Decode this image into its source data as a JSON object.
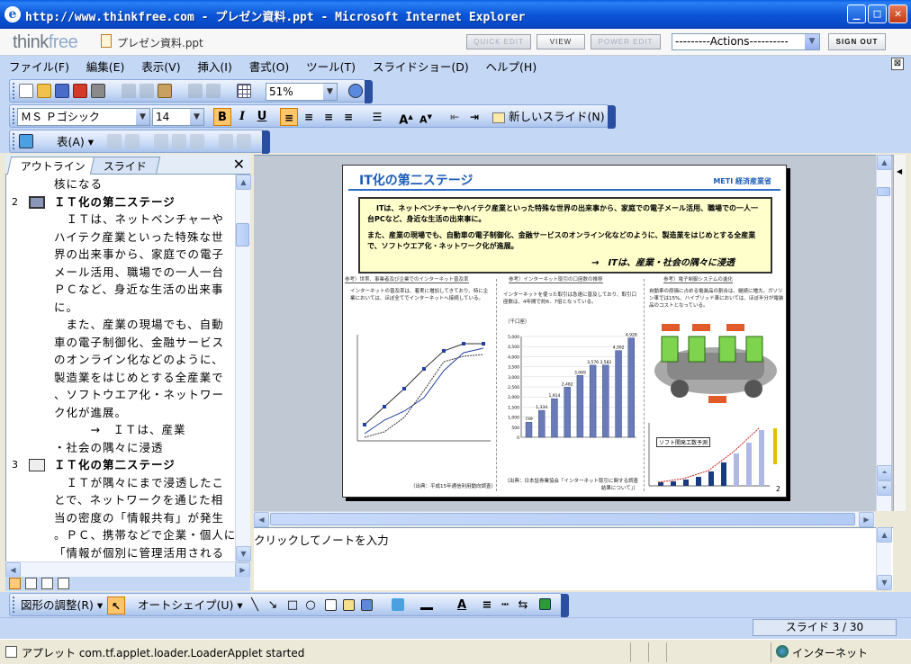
{
  "window": {
    "title": "http://www.thinkfree.com - プレゼン資料.ppt - Microsoft Internet Explorer",
    "ie_icon": "e"
  },
  "header": {
    "logo_think": "think",
    "logo_free": "free",
    "filename": "プレゼン資料.ppt",
    "quick_edit": "QUICK EDIT",
    "view": "VIEW",
    "power_edit": "POWER EDIT",
    "actions": "---------Actions----------",
    "sign_out": "SIGN OUT"
  },
  "menu": [
    "ファイル(F)",
    "編集(E)",
    "表示(V)",
    "挿入(I)",
    "書式(O)",
    "ツール(T)",
    "スライドショー(D)",
    "ヘルプ(H)"
  ],
  "toolbar": {
    "zoom": "51%",
    "font": "ＭＳ Ｐゴシック",
    "size": "14",
    "bold": "B",
    "italic": "I",
    "underline": "U",
    "new_slide": "新しいスライド(N)",
    "table": "表(A)"
  },
  "outline": {
    "tab_outline": "アウトライン",
    "tab_slide": "スライド",
    "lines": [
      {
        "text": "核になる",
        "indent": 1
      },
      {
        "num": "2",
        "title": "ＩＴ化の第二ステージ",
        "selected": true
      },
      {
        "text": "　ＩＴは、ネットベンチャーや",
        "indent": 1
      },
      {
        "text": "ハイテク産業といった特殊な世",
        "indent": 1
      },
      {
        "text": "界の出来事から、家庭での電子",
        "indent": 1
      },
      {
        "text": "メール活用、職場での一人一台",
        "indent": 1
      },
      {
        "text": "ＰＣなど、身近な生活の出来事",
        "indent": 1
      },
      {
        "text": "に。",
        "indent": 1
      },
      {
        "text": "　また、産業の現場でも、自動",
        "indent": 1
      },
      {
        "text": "車の電子制御化、金融サービス",
        "indent": 1
      },
      {
        "text": "のオンライン化などのように、",
        "indent": 1
      },
      {
        "text": "製造業をはじめとする全産業で",
        "indent": 1
      },
      {
        "text": "、ソフトウエア化・ネットワー",
        "indent": 1
      },
      {
        "text": "ク化が進展。",
        "indent": 1
      },
      {
        "text": "　　　→　ＩＴは、産業",
        "indent": 1
      },
      {
        "text": "・社会の隅々に浸透",
        "indent": 1
      },
      {
        "num": "3",
        "title": "ＩＴ化の第二ステージ",
        "selected": false
      },
      {
        "text": "　ＩＴが隅々にまで浸透したこ",
        "indent": 1
      },
      {
        "text": "とで、ネットワークを通じた相",
        "indent": 1
      },
      {
        "text": "当の密度の「情報共有」が発生",
        "indent": 1
      },
      {
        "text": "。ＰＣ、携帯などで企業・個人に",
        "indent": 1
      },
      {
        "text": "「情報が個別に管理活用される",
        "indent": 1
      },
      {
        "text": "」段階から、電子タグ、ネット",
        "indent": 1
      }
    ]
  },
  "slide": {
    "title": "IT化の第二ステージ",
    "logo": "METI 経済産業省",
    "box_p1": "ITは、ネットベンチャーやハイテク産業といった特殊な世界の出来事から、家庭での電子メール活用、職場での一人一台PCなど、身近な生活の出来事に。",
    "box_p2": "また、産業の現場でも、自動車の電子制御化、金融サービスのオンライン化などのように、製造業をはじめとする全産業で、ソフトウエア化・ネットワーク化が進展。",
    "box_concl": "→　ITは、産業・社会の隅々に浸透",
    "panel1_head": "参考）世帯、事業者及び企業でのインターネット普及率",
    "panel2_head": "参考）インターネット取引の口座数の推移",
    "panel3_head": "参考）電子制御システムの進化",
    "panel1_text": "インターネットの普及率は、着実に増加してきており、特に企業においては、ほぼ全てでインターネットへ接続している。",
    "panel2_text": "インターネットを使った取引は急速に普及しており、取引口座数は、4年間で約6．7倍となっている。",
    "panel3_text": "自動車の原価に占める電装品の割合は、継続に増大。ガソリン車では15%、ハイブリッド車においては、ほぼ半分が電装品のコストとなっている。",
    "source1": "（出典：平成15年通信利用動向調査）",
    "source2": "（出典：日本証券業協会「インターネット取引に関する調査結果について」）",
    "software_label": "ソフト開発工数予測",
    "page": "2"
  },
  "bar_chart": {
    "type": "bar",
    "ylabel": "（千口座）",
    "values": [
      749,
      1334,
      1914,
      2482,
      3069,
      3576,
      3582,
      4302,
      4928
    ],
    "ylim": [
      0,
      5000
    ]
  },
  "notes": {
    "placeholder": "クリックしてノートを入力"
  },
  "drawbar": {
    "adjust": "図形の調整(R)",
    "autoshape": "オートシェイプ(U)"
  },
  "status": {
    "slide_count": "スライド 3 / 30",
    "message": "アプレット com.tf.applet.loader.LoaderApplet started",
    "zone": "インターネット"
  },
  "colors": {
    "title_blue": "#0a5ee6",
    "app_bg": "#c4d7f5",
    "slide_title": "#1c5db8",
    "highlight_box": "#ffffcc"
  }
}
